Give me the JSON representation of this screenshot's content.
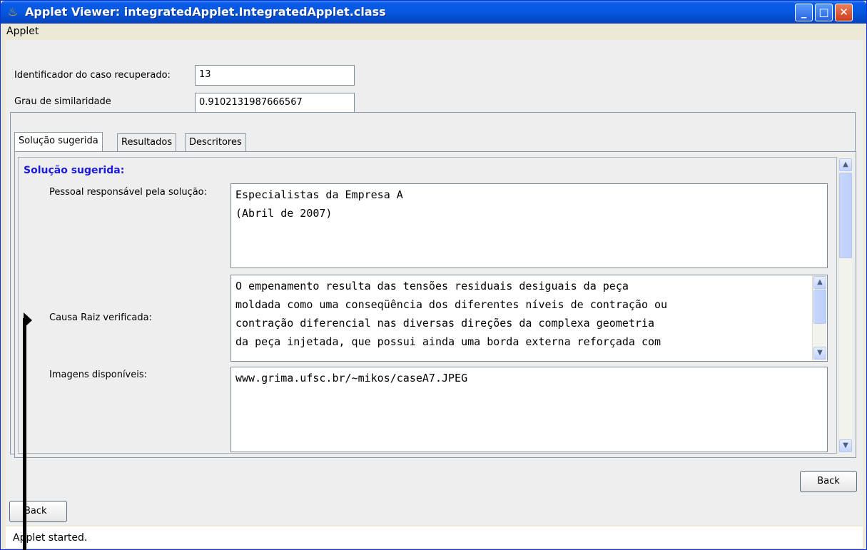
{
  "window": {
    "title": "Applet Viewer: integratedApplet.IntegratedApplet.class"
  },
  "menu": {
    "applet": "Applet"
  },
  "fields": {
    "case_id_label": "Identificador do caso recuperado:",
    "case_id_value": "13",
    "similarity_label": "Grau de similaridade",
    "similarity_value": "0.9102131987666567"
  },
  "tabs": [
    {
      "label": "Solução sugerida",
      "active": true
    },
    {
      "label": "Resultados",
      "active": false
    },
    {
      "label": "Descritores",
      "active": false
    }
  ],
  "solution": {
    "section_title": "Solução sugerida:",
    "personnel_label": "Pessoal responsável pela solução:",
    "personnel_lines": [
      "Especialistas da Empresa A",
      "(Abril de 2007)"
    ],
    "root_cause_label": "Causa Raiz verificada:",
    "root_cause_lines": [
      "O empenamento resulta das tensões residuais desiguais da peça",
      "moldada como uma conseqüência dos diferentes níveis de contração ou",
      "contração diferencial nas diversas direções da complexa geometria",
      "da peça injetada, que possui ainda uma borda externa reforçada com"
    ],
    "images_label": "Imagens disponíveis:",
    "images_value": "www.grima.ufsc.br/~mikos/caseA7.JPEG"
  },
  "buttons": {
    "back_right": "Back",
    "back_left": "Back"
  },
  "status": {
    "text": "Applet started."
  }
}
